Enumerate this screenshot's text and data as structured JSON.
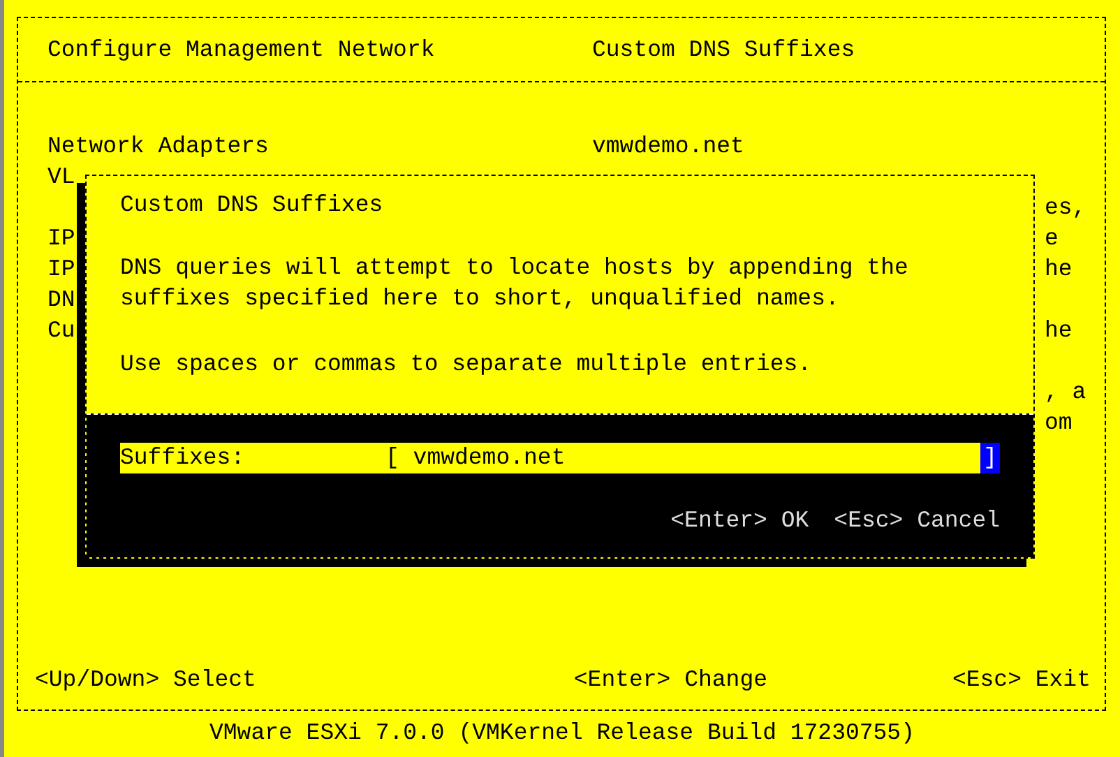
{
  "header": {
    "title": "Configure Management Network",
    "section": "Custom DNS Suffixes"
  },
  "background_screen": {
    "left_lines": [
      [
        "Network Adapters",
        "VL"
      ],
      [
        "IP",
        "IP",
        "DN",
        "Cu"
      ]
    ],
    "right_lines": [
      "vmwdemo.net"
    ],
    "right_edge_fragments": [
      [
        "es,",
        "e",
        "he"
      ],
      [
        "he"
      ],
      [
        ", a",
        "om"
      ]
    ]
  },
  "dialog": {
    "title": "Custom DNS Suffixes",
    "paragraphs": [
      "DNS queries will attempt to locate hosts by appending the suffixes specified here to short, unqualified names.",
      "Use spaces or commas to separate multiple entries."
    ],
    "field": {
      "label": "Suffixes:",
      "left_bracket": "[",
      "value": "vmwdemo.net",
      "right_bracket": "]",
      "focused": true
    },
    "actions": [
      "<Enter> OK",
      "<Esc> Cancel"
    ]
  },
  "footer": [
    "<Up/Down> Select",
    "<Enter> Change",
    "<Esc> Exit"
  ],
  "status_bar": "VMware ESXi 7.0.0 (VMKernel Release Build 17230755)"
}
